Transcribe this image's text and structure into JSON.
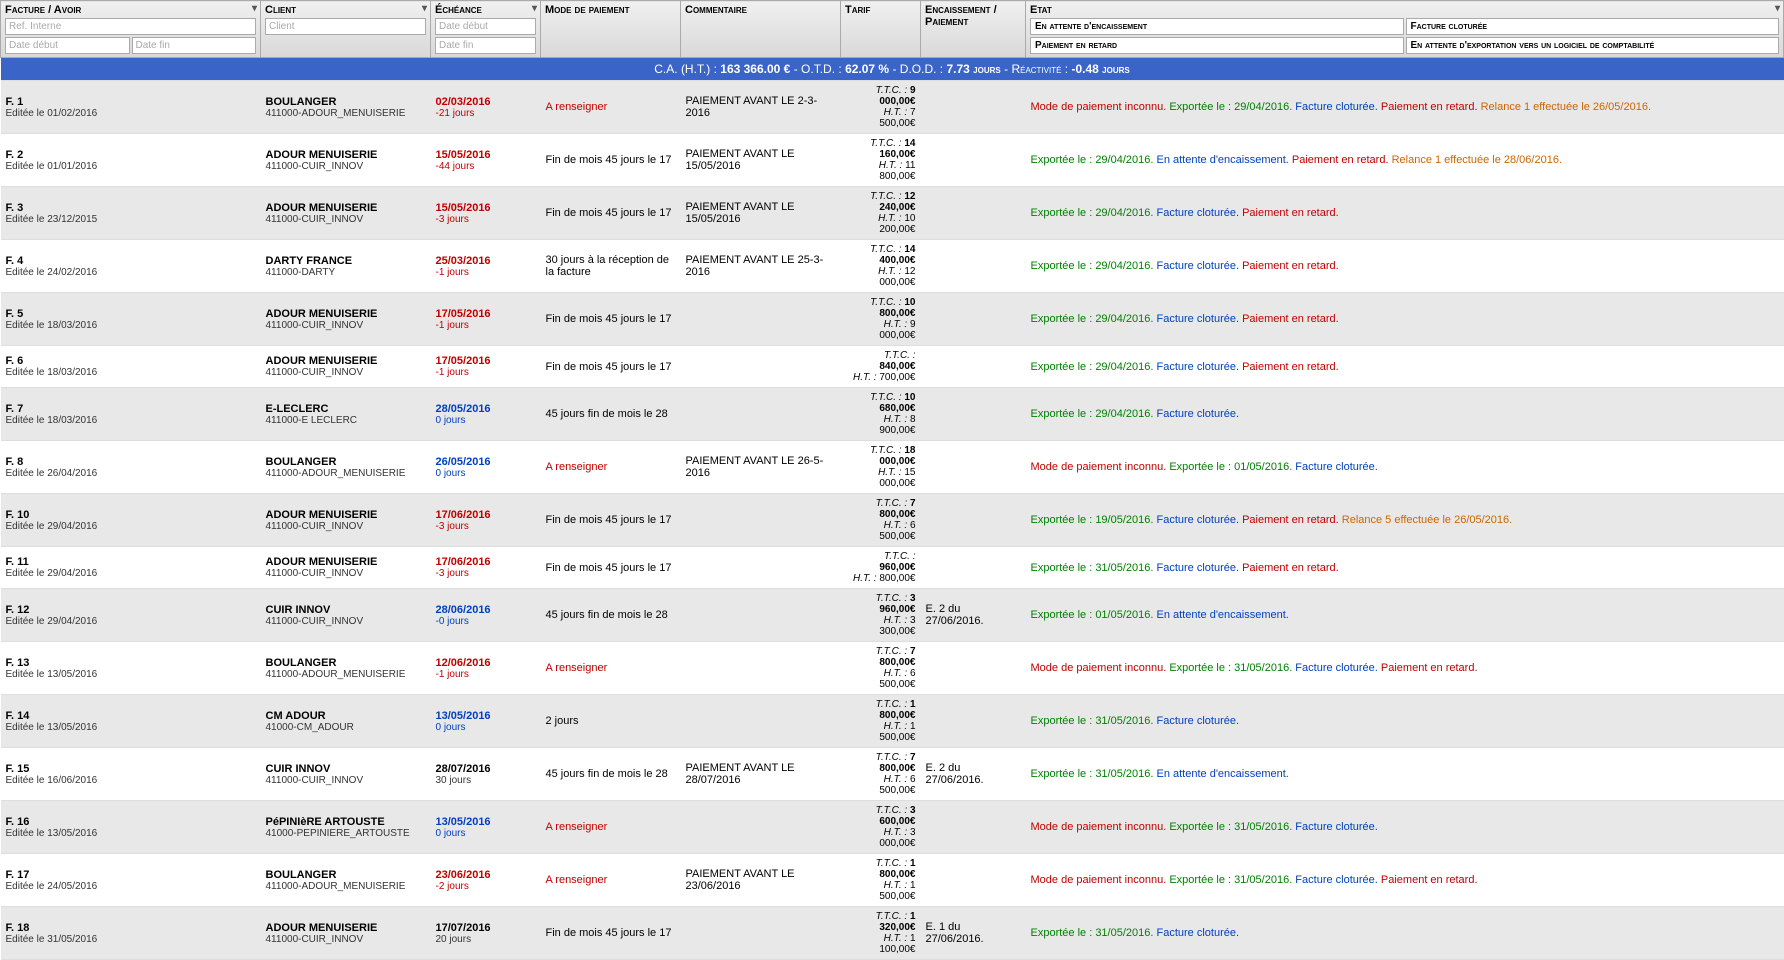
{
  "headers": {
    "facture": "Facture / Avoir",
    "client": "Client",
    "echeance": "Échéance",
    "mode": "Mode de paiement",
    "commentaire": "Commentaire",
    "tarif": "Tarif",
    "encaissement": "Encaissement / Paiement",
    "etat": "Etat",
    "ph_ref": "Ref. Interne",
    "ph_datedeb": "Date début",
    "ph_datefin": "Date fin",
    "ph_client": "Client",
    "state_btns": [
      "En attente d'encaissement",
      "Facture cloturée",
      "Paiement en retard",
      "En attente d'exportation vers un logiciel de comptabilité"
    ]
  },
  "summary": {
    "label_ca": "C.A. (H.T.) :",
    "ca": "163 366.00 €",
    "sep": " - ",
    "label_otd": "O.T.D. :",
    "otd": "62.07 %",
    "label_dod": "D.O.D. :",
    "dod": "7.73 jours",
    "label_react": "Réactivité :",
    "react": "-0.48 jours"
  },
  "rows": [
    {
      "ref": "F. 1",
      "edit": "Editée le 01/02/2016",
      "client": "BOULANGER",
      "client_sub": "411000-ADOUR_MENUISERIE",
      "ech": "02/03/2016",
      "ech_sub": "-21 jours",
      "ech_class": "red",
      "mode": "A renseigner",
      "mode_class": "red",
      "comm": "PAIEMENT AVANT LE 2-3-2016",
      "ttc": "9 000,00€",
      "ht": "7 500,00€",
      "enc": "",
      "etat": [
        {
          "t": "Mode de paiement inconnu.",
          "c": "red"
        },
        {
          "t": " Exportée le : 29/04/2016.",
          "c": "green"
        },
        {
          "t": " Facture cloturée.",
          "c": "blue"
        },
        {
          "t": " Paiement en retard.",
          "c": "red"
        },
        {
          "t": " Relance 1 effectuée le 26/05/2016.",
          "c": "orange"
        }
      ]
    },
    {
      "ref": "F. 2",
      "edit": "Editée le 01/01/2016",
      "client": "ADOUR MENUISERIE",
      "client_sub": "411000-CUIR_INNOV",
      "ech": "15/05/2016",
      "ech_sub": "-44 jours",
      "ech_class": "red",
      "mode": "Fin de mois 45 jours le 17",
      "mode_class": "",
      "comm": "PAIEMENT AVANT LE 15/05/2016",
      "ttc": "14 160,00€",
      "ht": "11 800,00€",
      "enc": "",
      "etat": [
        {
          "t": "Exportée le : 29/04/2016.",
          "c": "green"
        },
        {
          "t": " En attente d'encaissement.",
          "c": "blue"
        },
        {
          "t": " Paiement en retard.",
          "c": "red"
        },
        {
          "t": " Relance 1 effectuée le 28/06/2016.",
          "c": "orange"
        }
      ]
    },
    {
      "ref": "F. 3",
      "edit": "Editée le 23/12/2015",
      "client": "ADOUR MENUISERIE",
      "client_sub": "411000-CUIR_INNOV",
      "ech": "15/05/2016",
      "ech_sub": "-3 jours",
      "ech_class": "red",
      "mode": "Fin de mois 45 jours le 17",
      "mode_class": "",
      "comm": "PAIEMENT AVANT LE 15/05/2016",
      "ttc": "12 240,00€",
      "ht": "10 200,00€",
      "enc": "",
      "etat": [
        {
          "t": "Exportée le : 29/04/2016.",
          "c": "green"
        },
        {
          "t": " Facture cloturée.",
          "c": "blue"
        },
        {
          "t": " Paiement en retard.",
          "c": "red"
        }
      ]
    },
    {
      "ref": "F. 4",
      "edit": "Editée le 24/02/2016",
      "client": "DARTY FRANCE",
      "client_sub": "411000-DARTY",
      "ech": "25/03/2016",
      "ech_sub": "-1 jours",
      "ech_class": "red",
      "mode": "30 jours à la réception de la facture",
      "mode_class": "",
      "comm": "PAIEMENT AVANT LE 25-3-2016",
      "ttc": "14 400,00€",
      "ht": "12 000,00€",
      "enc": "",
      "etat": [
        {
          "t": "Exportée le : 29/04/2016.",
          "c": "green"
        },
        {
          "t": " Facture cloturée.",
          "c": "blue"
        },
        {
          "t": " Paiement en retard.",
          "c": "red"
        }
      ]
    },
    {
      "ref": "F. 5",
      "edit": "Editée le 18/03/2016",
      "client": "ADOUR MENUISERIE",
      "client_sub": "411000-CUIR_INNOV",
      "ech": "17/05/2016",
      "ech_sub": "-1 jours",
      "ech_class": "red",
      "mode": "Fin de mois 45 jours le 17",
      "mode_class": "",
      "comm": "",
      "ttc": "10 800,00€",
      "ht": "9 000,00€",
      "enc": "",
      "etat": [
        {
          "t": "Exportée le : 29/04/2016.",
          "c": "green"
        },
        {
          "t": " Facture cloturée.",
          "c": "blue"
        },
        {
          "t": " Paiement en retard.",
          "c": "red"
        }
      ]
    },
    {
      "ref": "F. 6",
      "edit": "Editée le 18/03/2016",
      "client": "ADOUR MENUISERIE",
      "client_sub": "411000-CUIR_INNOV",
      "ech": "17/05/2016",
      "ech_sub": "-1 jours",
      "ech_class": "red",
      "mode": "Fin de mois 45 jours le 17",
      "mode_class": "",
      "comm": "",
      "ttc": "840,00€",
      "ht": "700,00€",
      "enc": "",
      "etat": [
        {
          "t": "Exportée le : 29/04/2016.",
          "c": "green"
        },
        {
          "t": " Facture cloturée.",
          "c": "blue"
        },
        {
          "t": " Paiement en retard.",
          "c": "red"
        }
      ]
    },
    {
      "ref": "F. 7",
      "edit": "Editée le 18/03/2016",
      "client": "E-LECLERC",
      "client_sub": "411000-E LECLERC",
      "ech": "28/05/2016",
      "ech_sub": "0 jours",
      "ech_class": "blue",
      "mode": "45 jours fin de mois le 28",
      "mode_class": "",
      "comm": "",
      "ttc": "10 680,00€",
      "ht": "8 900,00€",
      "enc": "",
      "etat": [
        {
          "t": "Exportée le : 29/04/2016.",
          "c": "green"
        },
        {
          "t": " Facture cloturée.",
          "c": "blue"
        }
      ]
    },
    {
      "ref": "F. 8",
      "edit": "Editée le 26/04/2016",
      "client": "BOULANGER",
      "client_sub": "411000-ADOUR_MENUISERIE",
      "ech": "26/05/2016",
      "ech_sub": "0 jours",
      "ech_class": "blue",
      "mode": "A renseigner",
      "mode_class": "red",
      "comm": "PAIEMENT AVANT LE 26-5-2016",
      "ttc": "18 000,00€",
      "ht": "15 000,00€",
      "enc": "",
      "etat": [
        {
          "t": "Mode de paiement inconnu.",
          "c": "red"
        },
        {
          "t": " Exportée le : 01/05/2016.",
          "c": "green"
        },
        {
          "t": " Facture cloturée.",
          "c": "blue"
        }
      ]
    },
    {
      "ref": "F. 10",
      "edit": "Editée le 29/04/2016",
      "client": "ADOUR MENUISERIE",
      "client_sub": "411000-CUIR_INNOV",
      "ech": "17/06/2016",
      "ech_sub": "-3 jours",
      "ech_class": "red",
      "mode": "Fin de mois 45 jours le 17",
      "mode_class": "",
      "comm": "",
      "ttc": "7 800,00€",
      "ht": "6 500,00€",
      "enc": "",
      "etat": [
        {
          "t": "Exportée le : 19/05/2016.",
          "c": "green"
        },
        {
          "t": " Facture cloturée.",
          "c": "blue"
        },
        {
          "t": " Paiement en retard.",
          "c": "red"
        },
        {
          "t": " Relance 5 effectuée le 26/05/2016.",
          "c": "orange"
        }
      ]
    },
    {
      "ref": "F. 11",
      "edit": "Editée le 29/04/2016",
      "client": "ADOUR MENUISERIE",
      "client_sub": "411000-CUIR_INNOV",
      "ech": "17/06/2016",
      "ech_sub": "-3 jours",
      "ech_class": "red",
      "mode": "Fin de mois 45 jours le 17",
      "mode_class": "",
      "comm": "",
      "ttc": "960,00€",
      "ht": "800,00€",
      "enc": "",
      "etat": [
        {
          "t": "Exportée le : 31/05/2016.",
          "c": "green"
        },
        {
          "t": " Facture cloturée.",
          "c": "blue"
        },
        {
          "t": " Paiement en retard.",
          "c": "red"
        }
      ]
    },
    {
      "ref": "F. 12",
      "edit": "Editée le 29/04/2016",
      "client": "CUIR INNOV",
      "client_sub": "411000-CUIR_INNOV",
      "ech": "28/06/2016",
      "ech_sub": "-0 jours",
      "ech_class": "blue",
      "mode": "45 jours fin de mois le 28",
      "mode_class": "",
      "comm": "",
      "ttc": "3 960,00€",
      "ht": "3 300,00€",
      "enc": "E. 2 du 27/06/2016.",
      "etat": [
        {
          "t": "Exportée le : 01/05/2016.",
          "c": "green"
        },
        {
          "t": " En attente d'encaissement.",
          "c": "blue"
        }
      ]
    },
    {
      "ref": "F. 13",
      "edit": "Editée le 13/05/2016",
      "client": "BOULANGER",
      "client_sub": "411000-ADOUR_MENUISERIE",
      "ech": "12/06/2016",
      "ech_sub": "-1 jours",
      "ech_class": "red",
      "mode": "A renseigner",
      "mode_class": "red",
      "comm": "",
      "ttc": "7 800,00€",
      "ht": "6 500,00€",
      "enc": "",
      "etat": [
        {
          "t": "Mode de paiement inconnu.",
          "c": "red"
        },
        {
          "t": " Exportée le : 31/05/2016.",
          "c": "green"
        },
        {
          "t": " Facture cloturée.",
          "c": "blue"
        },
        {
          "t": " Paiement en retard.",
          "c": "red"
        }
      ]
    },
    {
      "ref": "F. 14",
      "edit": "Editée le 13/05/2016",
      "client": "CM ADOUR",
      "client_sub": "41000-CM_ADOUR",
      "ech": "13/05/2016",
      "ech_sub": "0 jours",
      "ech_class": "blue",
      "mode": "2 jours",
      "mode_class": "",
      "comm": "",
      "ttc": "1 800,00€",
      "ht": "1 500,00€",
      "enc": "",
      "etat": [
        {
          "t": "Exportée le : 31/05/2016.",
          "c": "green"
        },
        {
          "t": " Facture cloturée.",
          "c": "blue"
        }
      ]
    },
    {
      "ref": "F. 15",
      "edit": "Editée le 16/06/2016",
      "client": "CUIR INNOV",
      "client_sub": "411000-CUIR_INNOV",
      "ech": "28/07/2016",
      "ech_sub": "30 jours",
      "ech_class": "",
      "mode": "45 jours fin de mois le 28",
      "mode_class": "",
      "comm": "PAIEMENT AVANT LE 28/07/2016",
      "ttc": "7 800,00€",
      "ht": "6 500,00€",
      "enc": "E. 2 du 27/06/2016.",
      "etat": [
        {
          "t": "Exportée le : 31/05/2016.",
          "c": "green"
        },
        {
          "t": " En attente d'encaissement.",
          "c": "blue"
        }
      ]
    },
    {
      "ref": "F. 16",
      "edit": "Editée le 13/05/2016",
      "client": "PéPINIèRE ARTOUSTE",
      "client_sub": "41000-PEPINIERE_ARTOUSTE",
      "ech": "13/05/2016",
      "ech_sub": "0 jours",
      "ech_class": "blue",
      "mode": "A renseigner",
      "mode_class": "red",
      "comm": "",
      "ttc": "3 600,00€",
      "ht": "3 000,00€",
      "enc": "",
      "etat": [
        {
          "t": "Mode de paiement inconnu.",
          "c": "red"
        },
        {
          "t": " Exportée le : 31/05/2016.",
          "c": "green"
        },
        {
          "t": " Facture cloturée.",
          "c": "blue"
        }
      ]
    },
    {
      "ref": "F. 17",
      "edit": "Editée le 24/05/2016",
      "client": "BOULANGER",
      "client_sub": "411000-ADOUR_MENUISERIE",
      "ech": "23/06/2016",
      "ech_sub": "-2 jours",
      "ech_class": "red",
      "mode": "A renseigner",
      "mode_class": "red",
      "comm": "PAIEMENT AVANT LE 23/06/2016",
      "ttc": "1 800,00€",
      "ht": "1 500,00€",
      "enc": "",
      "etat": [
        {
          "t": "Mode de paiement inconnu.",
          "c": "red"
        },
        {
          "t": " Exportée le : 31/05/2016.",
          "c": "green"
        },
        {
          "t": " Facture cloturée.",
          "c": "blue"
        },
        {
          "t": " Paiement en retard.",
          "c": "red"
        }
      ]
    },
    {
      "ref": "F. 18",
      "edit": "Editée le 31/05/2016",
      "client": "ADOUR MENUISERIE",
      "client_sub": "411000-CUIR_INNOV",
      "ech": "17/07/2016",
      "ech_sub": "20 jours",
      "ech_class": "",
      "mode": "Fin de mois 45 jours le 17",
      "mode_class": "",
      "comm": "",
      "ttc": "1 320,00€",
      "ht": "1 100,00€",
      "enc": "E. 1 du 27/06/2016.",
      "etat": [
        {
          "t": "Exportée le : 31/05/2016.",
          "c": "green"
        },
        {
          "t": " Facture cloturée.",
          "c": "blue"
        }
      ]
    }
  ]
}
